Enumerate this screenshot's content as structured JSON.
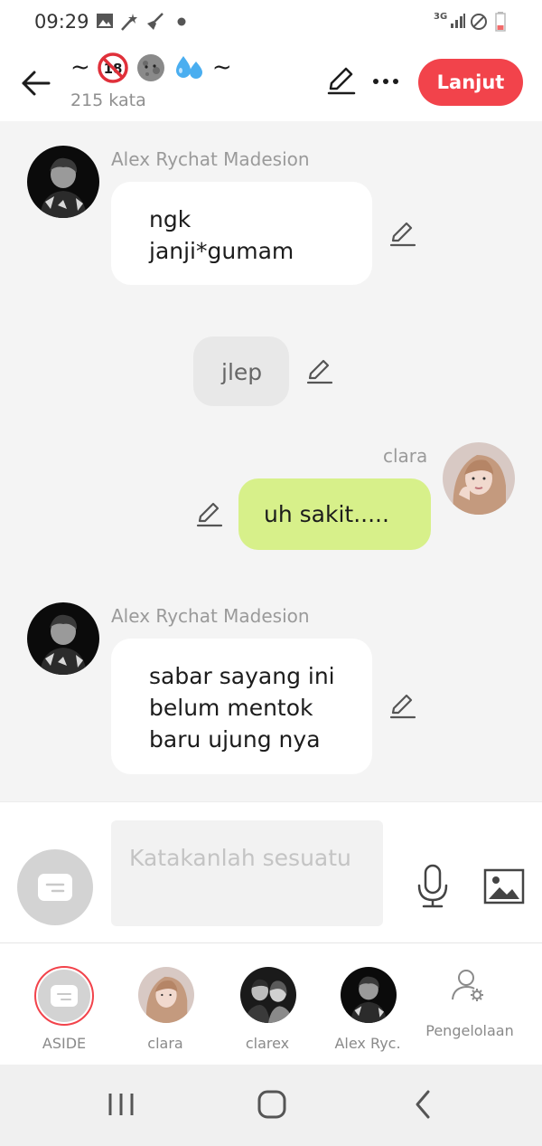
{
  "status_bar": {
    "time": "09:29",
    "network": "3G"
  },
  "header": {
    "title_prefix": "~",
    "title_suffix": "~",
    "title_emojis": [
      "no-under-18-emoji",
      "moon-face-emoji",
      "droplets-emoji"
    ],
    "word_count": "215 kata",
    "next_button_label": "Lanjut",
    "accent_color": "#f2434b"
  },
  "messages": [
    {
      "type": "character-left",
      "sender": "Alex Rychat Madesion",
      "text_lines": [
        "ngk",
        "janji*gumam"
      ]
    },
    {
      "type": "narration",
      "text": "jlep"
    },
    {
      "type": "character-right",
      "sender": "clara",
      "text": "uh sakit.....",
      "bubble_color": "#d7f08a"
    },
    {
      "type": "character-left",
      "sender": "Alex Rychat Madesion",
      "text_lines": [
        "sabar sayang ini",
        "belum mentok",
        "baru ujung nya"
      ]
    }
  ],
  "composer": {
    "placeholder": "Katakanlah sesuatu"
  },
  "characters": [
    {
      "label": "ASIDE",
      "selected": true
    },
    {
      "label": "clara"
    },
    {
      "label": "clarex"
    },
    {
      "label": "Alex Ryc."
    },
    {
      "label": "Pengelolaan"
    }
  ]
}
